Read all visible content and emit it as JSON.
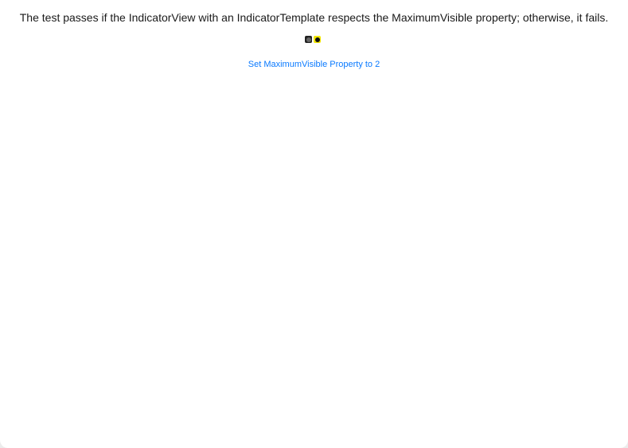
{
  "description": "The test passes if the IndicatorView with an IndicatorTemplate respects the MaximumVisible property; otherwise, it fails.",
  "indicators": [
    {
      "name": "indicator-1",
      "selected": false,
      "color": "#222222"
    },
    {
      "name": "indicator-2",
      "selected": true,
      "color": "#f2e600"
    }
  ],
  "button": {
    "label": "Set MaximumVisible Property to 2"
  }
}
